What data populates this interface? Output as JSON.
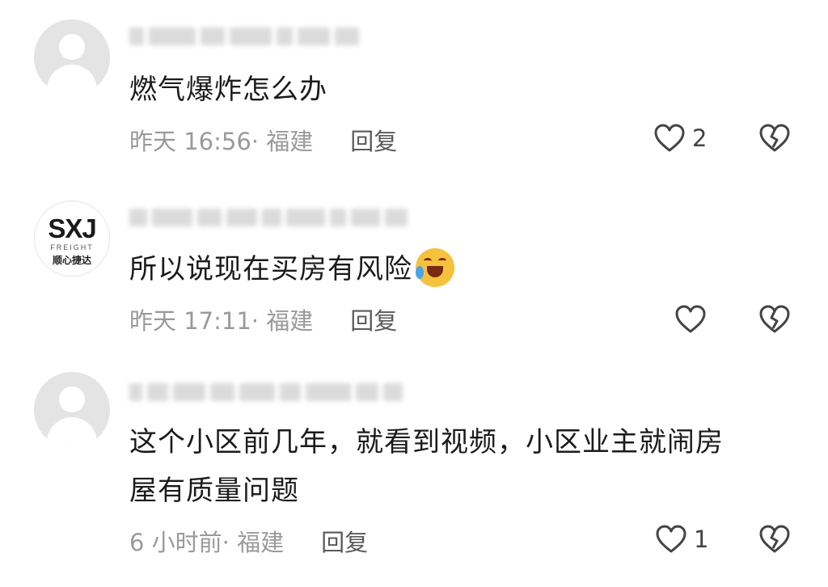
{
  "comments": [
    {
      "avatar": "default-avatar",
      "text": "燃气爆炸怎么办",
      "time": "昨天 16:56",
      "location": "· 福建",
      "reply": "回复",
      "likes": "2"
    },
    {
      "avatar": "brand-logo-avatar",
      "logo_mark": "SXJ",
      "logo_sub": "FREIGHT",
      "logo_cn": "顺心捷达",
      "text": "所以说现在买房有风险",
      "emoji": "laughing-crying-emoji",
      "time": "昨天 17:11",
      "location": "· 福建",
      "reply": "回复",
      "likes": ""
    },
    {
      "avatar": "default-avatar",
      "text_line1": "这个小区前几年，就看到视频，小区业主就闹房",
      "text_line2": "屋有质量问题",
      "time": "6 小时前",
      "location": " · 福建",
      "reply": "回复",
      "likes": "1"
    }
  ],
  "icons": {
    "like": "heart-outline-icon",
    "dislike": "broken-heart-icon"
  },
  "colors": {
    "meta_text": "#9a9a9a",
    "body_text": "#1b1b1b",
    "icon_stroke": "#444444"
  }
}
